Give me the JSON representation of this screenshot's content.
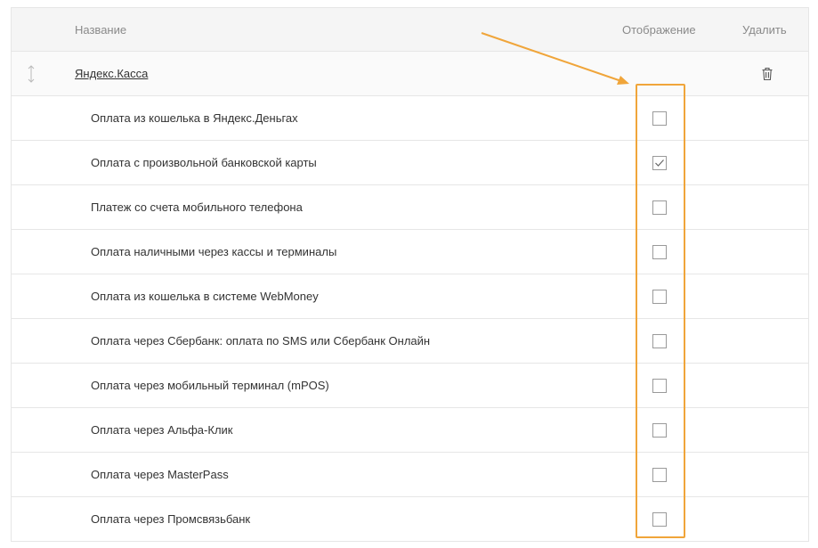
{
  "header": {
    "name": "Название",
    "display": "Отображение",
    "delete": "Удалить"
  },
  "group": {
    "name": "Яндекс.Касса",
    "drag_icon": "vertical-resize-icon",
    "delete_icon": "trash-icon"
  },
  "items": [
    {
      "name": "Оплата из кошелька в Яндекс.Деньгах",
      "checked": false
    },
    {
      "name": "Оплата с произвольной банковской карты",
      "checked": true
    },
    {
      "name": "Платеж со счета мобильного телефона",
      "checked": false
    },
    {
      "name": "Оплата наличными через кассы и терминалы",
      "checked": false
    },
    {
      "name": "Оплата из кошелька в системе WebMoney",
      "checked": false
    },
    {
      "name": "Оплата через Сбербанк: оплата по SMS или Сбербанк Онлайн",
      "checked": false
    },
    {
      "name": "Оплата через мобильный терминал (mPOS)",
      "checked": false
    },
    {
      "name": "Оплата через Альфа-Клик",
      "checked": false
    },
    {
      "name": "Оплата через MasterPass",
      "checked": false
    },
    {
      "name": "Оплата через Промсвязьбанк",
      "checked": false
    }
  ],
  "annotation": {
    "color": "#f0a53a"
  }
}
